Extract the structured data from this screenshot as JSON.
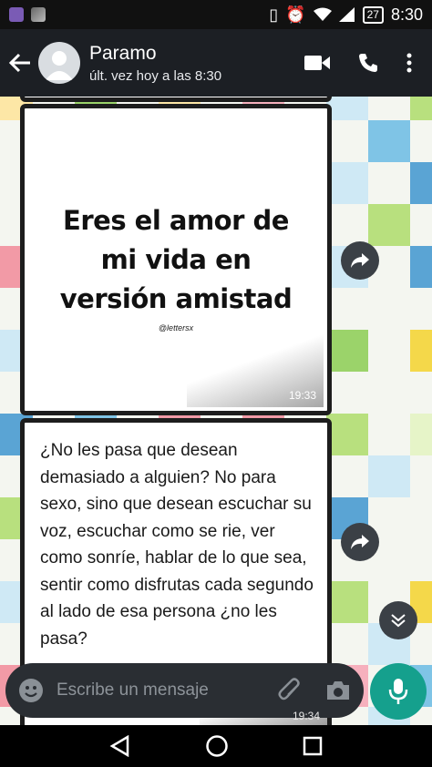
{
  "status_bar": {
    "battery": "27",
    "time": "8:30"
  },
  "header": {
    "contact_name": "Paramo",
    "last_seen": "últ. vez hoy a las 8:30"
  },
  "messages": [
    {
      "type": "image",
      "text_lines": [
        "Eres el amor de",
        "mi vida en",
        "versión amistad"
      ],
      "watermark": "@lettersx",
      "time": "19:33"
    },
    {
      "type": "text",
      "text": "¿No les pasa que desean demasiado a alguien? No para sexo, sino que desean escuchar su voz, escuchar como se rie, ver como sonríe, hablar de lo que sea, sentir como disfrutas cada segundo al lado de esa persona ¿no les pasa?",
      "time": "19:34"
    }
  ],
  "composer": {
    "placeholder": "Escribe un mensaje"
  },
  "colors": {
    "accent": "#15a08d",
    "header_bg": "#1c1f24",
    "bubble_bg": "#ffffff"
  },
  "icons": [
    "back-arrow-icon",
    "video-call-icon",
    "phone-icon",
    "more-options-icon",
    "forward-icon",
    "chevron-down-icon",
    "emoji-icon",
    "attach-icon",
    "camera-icon",
    "mic-icon",
    "nav-back-icon",
    "nav-home-icon",
    "nav-recents-icon"
  ]
}
